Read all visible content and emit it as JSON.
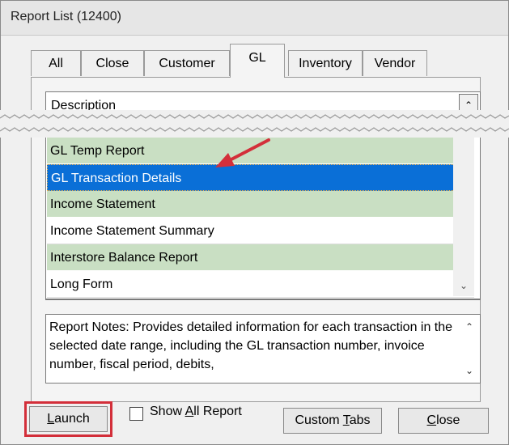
{
  "window": {
    "title": "Report List (12400)"
  },
  "tabs": [
    {
      "label": "All"
    },
    {
      "label": "Close"
    },
    {
      "label": "Customer"
    },
    {
      "label": "GL"
    },
    {
      "label": "Inventory"
    },
    {
      "label": "Vendor"
    }
  ],
  "active_tab": "GL",
  "list": {
    "header": "Description",
    "rows": [
      {
        "label": "GL Temp Report"
      },
      {
        "label": "GL Transaction Details"
      },
      {
        "label": "Income Statement"
      },
      {
        "label": "Income Statement Summary"
      },
      {
        "label": "Interstore Balance Report"
      },
      {
        "label": "Long Form"
      }
    ],
    "selected": "GL Transaction Details"
  },
  "notes": {
    "text": "Report Notes:  Provides detailed information for each transaction in the selected date range, including the GL transaction number, invoice number, fiscal period, debits,"
  },
  "buttons": {
    "launch": {
      "pre": "",
      "accel": "L",
      "post": "aunch"
    },
    "show_all": {
      "pre": "Show ",
      "accel": "A",
      "post": "ll Report"
    },
    "custom_tabs": {
      "pre": "Custom ",
      "accel": "T",
      "post": "abs"
    },
    "close": {
      "pre": "",
      "accel": "C",
      "post": "lose"
    }
  },
  "colors": {
    "selection": "#0a6fd7",
    "row_green": "#c9dfc3",
    "highlight_red": "#d32f3a"
  }
}
